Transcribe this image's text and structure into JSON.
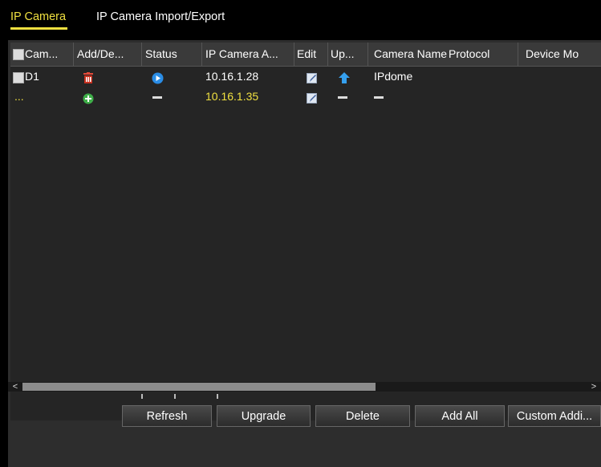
{
  "tabs": [
    {
      "label": "IP Camera",
      "active": true
    },
    {
      "label": "IP Camera Import/Export",
      "active": false
    }
  ],
  "table": {
    "headers": [
      "Cam...",
      "Add/De...",
      "Status",
      "IP Camera A...",
      "Edit",
      "Up...",
      "Camera Name",
      "Protocol",
      "Device Mo"
    ],
    "rows": [
      {
        "camera": "D1",
        "add_delete_icon": "delete-icon",
        "status_icon": "play-status-icon",
        "ip": "10.16.1.28",
        "edit_icon": "edit-icon",
        "upgrade_icon": "upgrade-icon",
        "camera_name": "IPdome",
        "protocol": "",
        "device_model": ""
      },
      {
        "camera": "...",
        "add_delete_icon": "add-icon",
        "status": "-",
        "ip": "10.16.1.35",
        "edit_icon": "edit-icon",
        "upgrade": "-",
        "camera_name": "-",
        "protocol": "",
        "device_model": ""
      }
    ]
  },
  "buttons": {
    "refresh": "Refresh",
    "upgrade": "Upgrade",
    "delete": "Delete",
    "add_all": "Add All",
    "custom_adding": "Custom Addi..."
  },
  "scrollbar": {
    "left_arrow": "<",
    "right_arrow": ">"
  },
  "colors": {
    "active_tab": "#f0e040",
    "new_row_text": "#f0e040",
    "panel_bg": "#2d2d2d"
  }
}
